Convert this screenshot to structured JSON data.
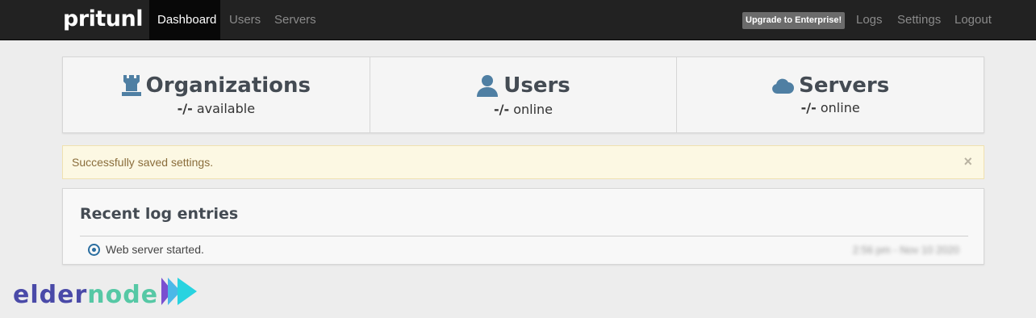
{
  "navbar": {
    "brand": "pritunl",
    "items": [
      {
        "label": "Dashboard",
        "active": true
      },
      {
        "label": "Users",
        "active": false
      },
      {
        "label": "Servers",
        "active": false
      }
    ],
    "upgrade_label": "Upgrade to Enterprise!",
    "right_items": [
      {
        "label": "Logs"
      },
      {
        "label": "Settings"
      },
      {
        "label": "Logout"
      }
    ]
  },
  "stats": [
    {
      "icon": "organization-icon",
      "title": "Organizations",
      "value": "-/-",
      "suffix": "available"
    },
    {
      "icon": "user-icon",
      "title": "Users",
      "value": "-/-",
      "suffix": "online"
    },
    {
      "icon": "cloud-icon",
      "title": "Servers",
      "value": "-/-",
      "suffix": "online"
    }
  ],
  "alert": {
    "message": "Successfully saved settings.",
    "close": "×"
  },
  "logs": {
    "title": "Recent log entries",
    "entries": [
      {
        "message": "Web server started.",
        "time": "2:56 pm - Nov 10 2020"
      }
    ]
  },
  "watermark": {
    "part1": "elder",
    "part2": "node"
  },
  "colors": {
    "navbar": "#222222",
    "icon": "#4f7fa3",
    "alert_bg": "#fcf8e3",
    "alert_text": "#8a6d3b",
    "watermark_primary": "#4a4aa8",
    "watermark_secondary": "#56c8a5"
  }
}
